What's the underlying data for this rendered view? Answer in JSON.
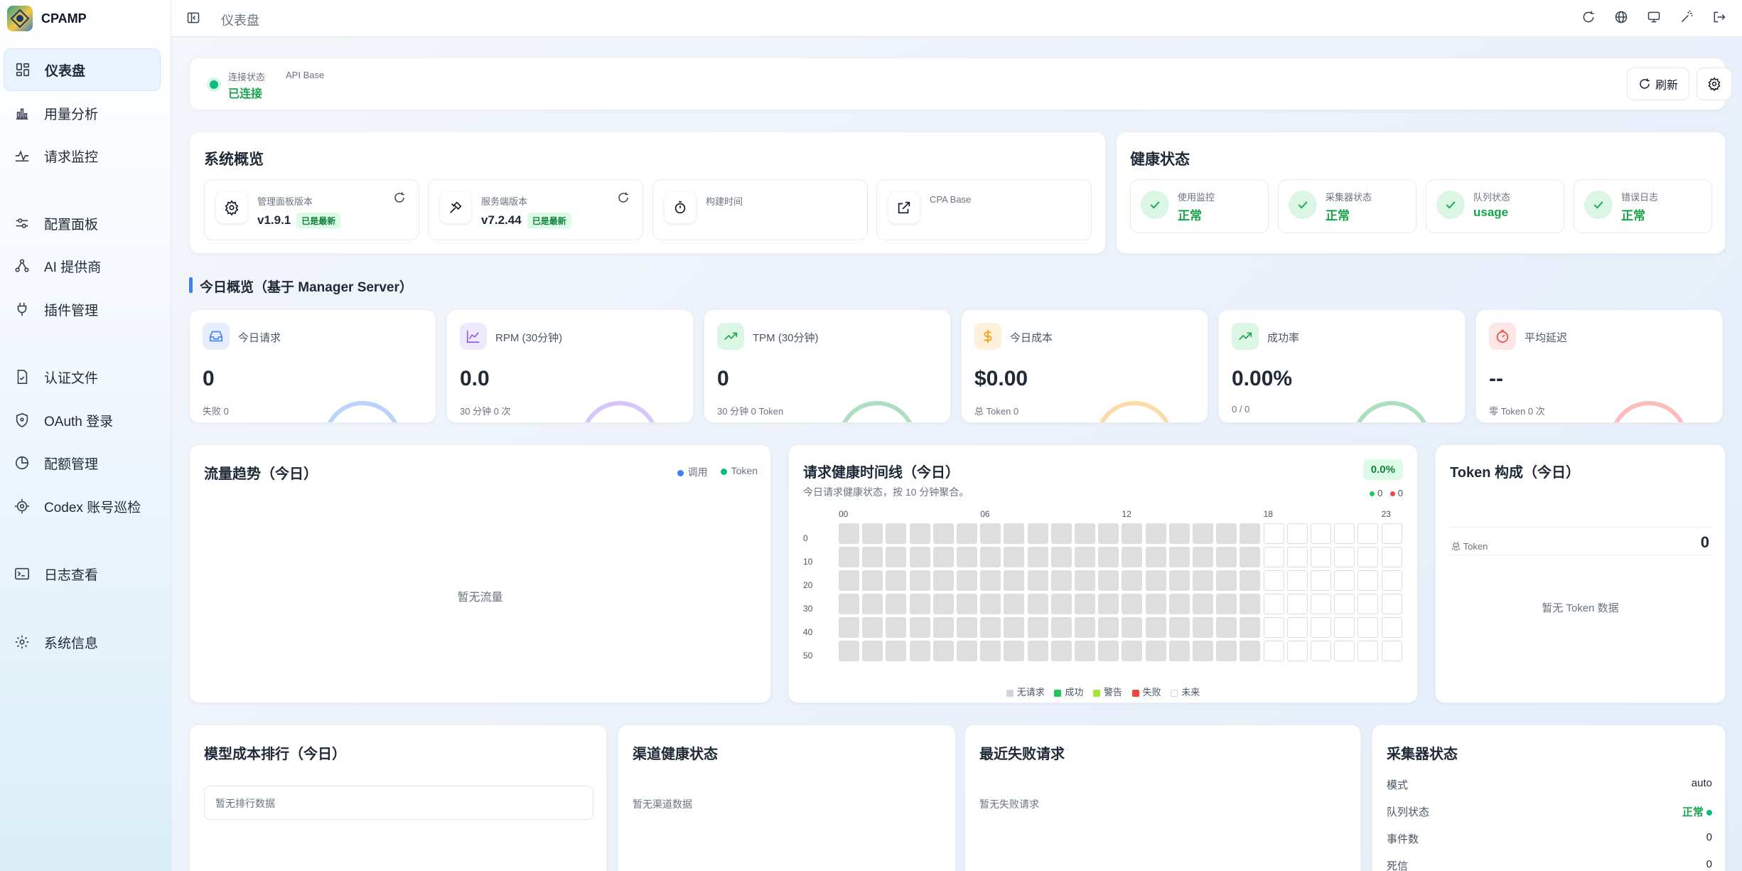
{
  "app": {
    "name": "CPAMP"
  },
  "sidebar": {
    "items": [
      {
        "label": "仪表盘",
        "icon": "dashboard-icon",
        "active": true
      },
      {
        "label": "用量分析",
        "icon": "bar-chart-icon"
      },
      {
        "label": "请求监控",
        "icon": "monitor-icon"
      },
      {
        "label": "配置面板",
        "icon": "sliders-icon"
      },
      {
        "label": "AI 提供商",
        "icon": "nodes-icon"
      },
      {
        "label": "插件管理",
        "icon": "plug-icon"
      },
      {
        "label": "认证文件",
        "icon": "file-check-icon"
      },
      {
        "label": "OAuth 登录",
        "icon": "shield-icon"
      },
      {
        "label": "配额管理",
        "icon": "pie-icon"
      },
      {
        "label": "Codex 账号巡检",
        "icon": "scan-icon"
      },
      {
        "label": "日志查看",
        "icon": "terminal-icon"
      },
      {
        "label": "系统信息",
        "icon": "chip-icon"
      }
    ]
  },
  "topbar": {
    "breadcrumb": "仪表盘",
    "icons": [
      "refresh-icon",
      "globe-icon",
      "display-icon",
      "magic-icon",
      "logout-icon"
    ]
  },
  "connection": {
    "status_label": "连接状态",
    "status_value": "已连接",
    "api_base_label": "API Base",
    "refresh_label": "刷新"
  },
  "system_overview": {
    "title": "系统概览",
    "items": [
      {
        "label": "管理面板版本",
        "value": "v1.9.1",
        "badge": "已是最新",
        "icon": "gear-icon"
      },
      {
        "label": "服务端版本",
        "value": "v7.2.44",
        "badge": "已是最新",
        "icon": "tools-icon"
      },
      {
        "label": "构建时间",
        "value": "",
        "icon": "stopwatch-icon"
      },
      {
        "label": "CPA Base",
        "value": "",
        "icon": "external-link-icon"
      }
    ]
  },
  "health": {
    "title": "健康状态",
    "items": [
      {
        "label": "使用监控",
        "value": "正常"
      },
      {
        "label": "采集器状态",
        "value": "正常"
      },
      {
        "label": "队列状态",
        "value": "usage"
      },
      {
        "label": "错误日志",
        "value": "正常"
      }
    ]
  },
  "today": {
    "title": "今日概览（基于 Manager Server）",
    "kpis": [
      {
        "label": "今日请求",
        "value": "0",
        "sub": "失败 0",
        "color": "#3b82f6",
        "icon": "inbox-icon"
      },
      {
        "label": "RPM (30分钟)",
        "value": "0.0",
        "sub": "30 分钟 0 次",
        "color": "#8b5cf6",
        "icon": "line-chart-icon"
      },
      {
        "label": "TPM (30分钟)",
        "value": "0",
        "sub": "30 分钟 0 Token",
        "color": "#16a34a",
        "icon": "trend-up-icon"
      },
      {
        "label": "今日成本",
        "value": "$0.00",
        "sub": "总 Token 0",
        "color": "#f59e0b",
        "icon": "dollar-icon"
      },
      {
        "label": "成功率",
        "value": "0.00%",
        "sub": "0 / 0",
        "color": "#16a34a",
        "icon": "trend-up-icon"
      },
      {
        "label": "平均延迟",
        "value": "--",
        "sub": "零 Token 0 次",
        "color": "#ef4444",
        "icon": "timer-icon"
      }
    ]
  },
  "traffic": {
    "title": "流量趋势（今日）",
    "legend": [
      {
        "name": "调用",
        "color": "#3b82f6"
      },
      {
        "name": "Token",
        "color": "#10b981"
      }
    ],
    "empty": "暂无流量"
  },
  "timeline": {
    "title": "请求健康时间线（今日）",
    "subtitle": "今日请求健康状态，按 10 分钟聚合。",
    "rate": "0.0%",
    "success_count": "0",
    "fail_count": "0",
    "hour_labels": [
      "00",
      "06",
      "12",
      "18",
      "23"
    ],
    "row_labels": [
      "0",
      "10",
      "20",
      "30",
      "40",
      "50"
    ],
    "past_hours": 18,
    "legend": [
      {
        "name": "无请求",
        "color": "#d1d5db"
      },
      {
        "name": "成功",
        "color": "#22c55e"
      },
      {
        "name": "警告",
        "color": "#a3e635"
      },
      {
        "name": "失败",
        "color": "#ef4444"
      },
      {
        "name": "未来",
        "color": "#ffffff"
      }
    ]
  },
  "token_mix": {
    "title": "Token 构成（今日）",
    "total_label": "总 Token",
    "total_value": "0",
    "empty": "暂无 Token 数据"
  },
  "model_rank": {
    "title": "模型成本排行（今日）",
    "empty": "暂无排行数据"
  },
  "channel_health": {
    "title": "渠道健康状态",
    "empty": "暂无渠道数据"
  },
  "recent_failures": {
    "title": "最近失败请求",
    "empty": "暂无失败请求"
  },
  "collector": {
    "title": "采集器状态",
    "rows": [
      {
        "label": "模式",
        "value": "auto"
      },
      {
        "label": "队列状态",
        "value": "正常"
      },
      {
        "label": "事件数",
        "value": "0"
      },
      {
        "label": "死信",
        "value": "0"
      }
    ]
  }
}
